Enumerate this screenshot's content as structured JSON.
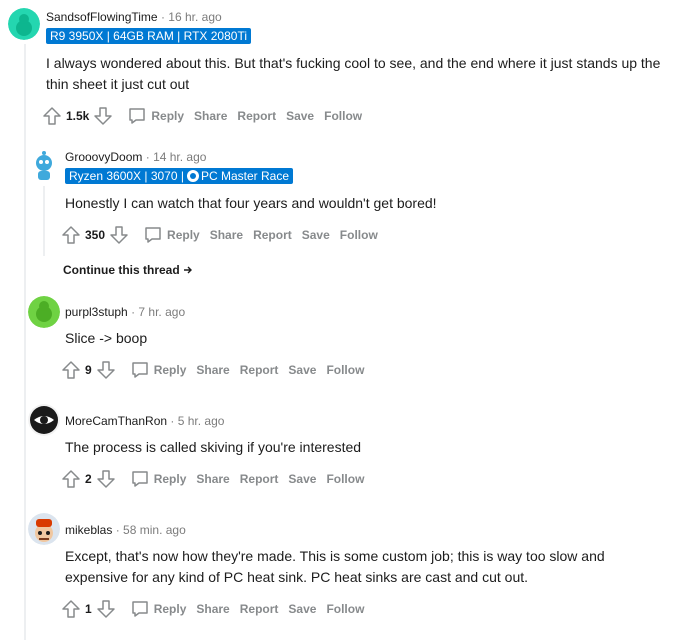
{
  "comments": [
    {
      "author": "SandsofFlowingTime",
      "time": "16 hr. ago",
      "flair": "R9 3950X | 64GB RAM | RTX 2080Ti",
      "body": "I always wondered about this. But that's fucking cool to see, and the end where it just stands up the thin sheet it just cut out",
      "score": "1.5k"
    },
    {
      "author": "GrooovyDoom",
      "time": "14 hr. ago",
      "flair_prefix": "Ryzen 3600X | 3070 |",
      "flair_suffix": "PC Master Race",
      "body": "Honestly I can watch that four years and wouldn't get bored!",
      "score": "350",
      "continue": "Continue this thread"
    },
    {
      "author": "purpl3stuph",
      "time": "7 hr. ago",
      "body": "Slice -> boop",
      "score": "9"
    },
    {
      "author": "MoreCamThanRon",
      "time": "5 hr. ago",
      "body": "The process is called skiving if you're interested",
      "score": "2"
    },
    {
      "author": "mikeblas",
      "time": "58 min. ago",
      "body": "Except, that's now how they're made. This is some custom job; this is way too slow and expensive for any kind of PC heat sink. PC heat sinks are cast and cut out.",
      "score": "1"
    }
  ],
  "actions": {
    "reply": "Reply",
    "share": "Share",
    "report": "Report",
    "save": "Save",
    "follow": "Follow"
  },
  "separator": "·",
  "colors": {
    "flair_bg": "#0079d3",
    "action_text": "#878a8c",
    "thread_line": "#edeff1"
  },
  "icons": [
    "upvote-icon",
    "downvote-icon",
    "comment-bubble-icon",
    "arrow-right-icon",
    "steam-icon"
  ]
}
